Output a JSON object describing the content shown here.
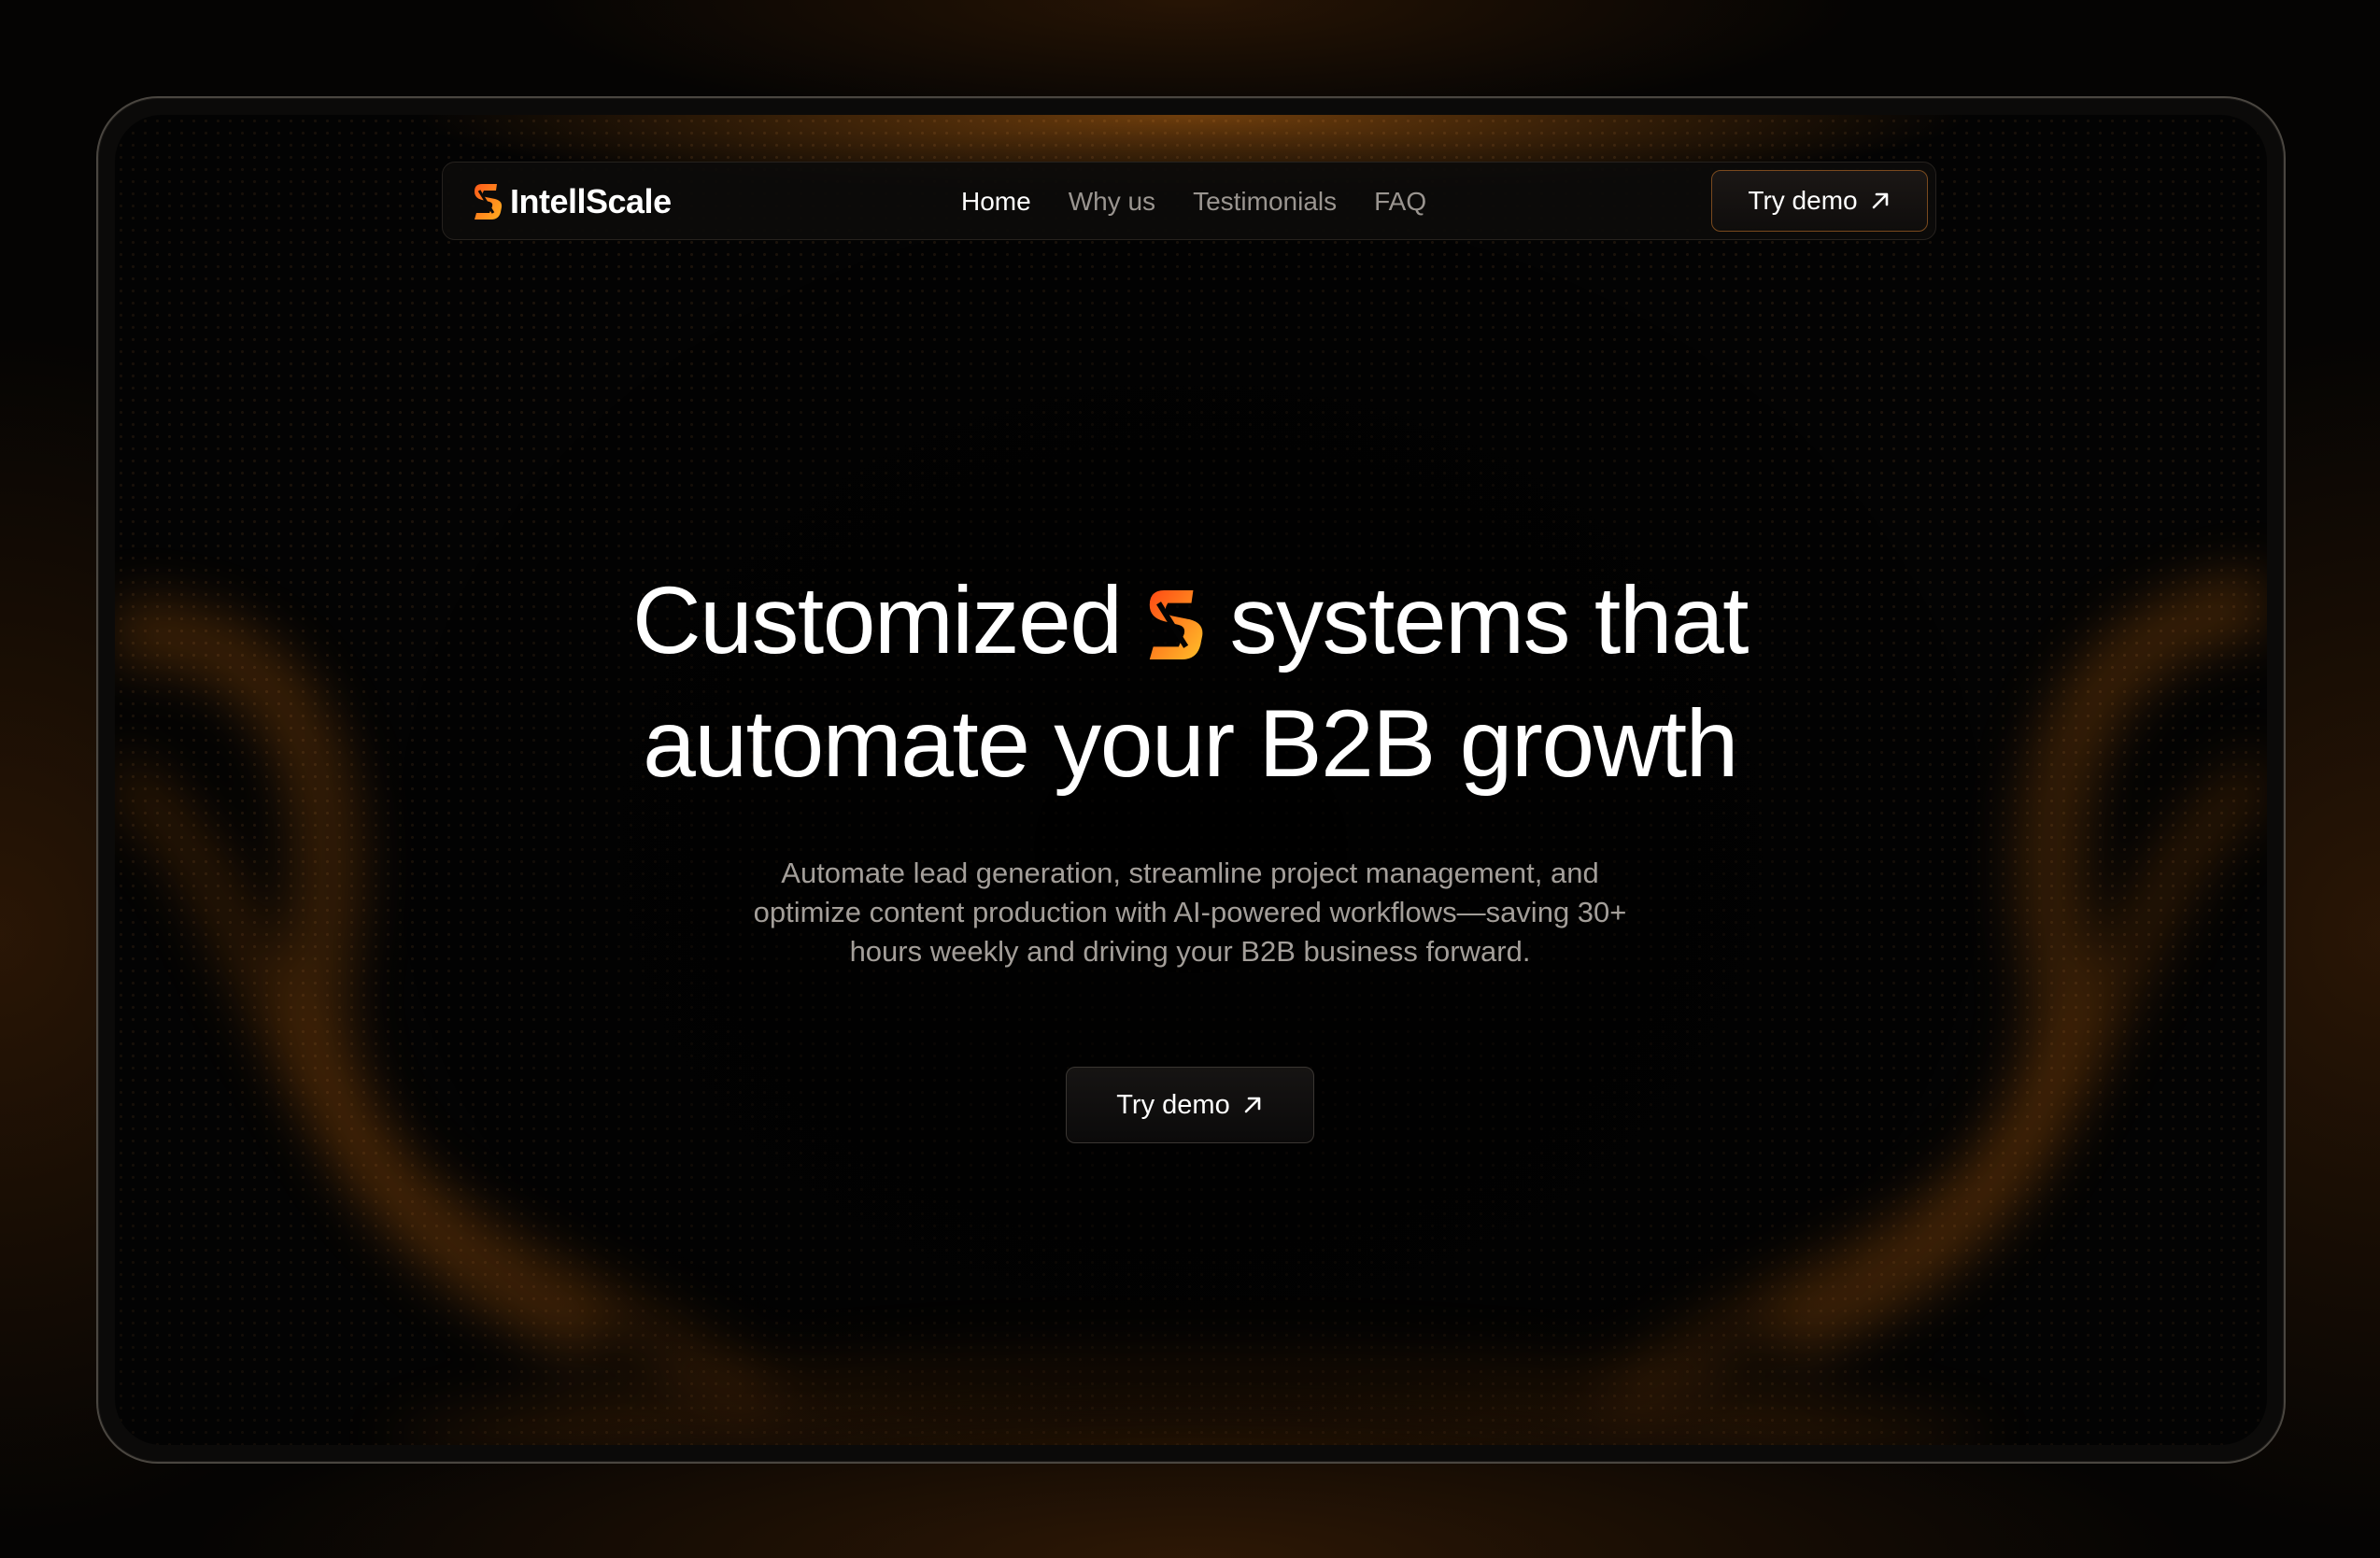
{
  "brand": {
    "name": "IntellScale",
    "logo_icon": "orange-s-bolt-logo",
    "accent_color": "#ff7a1a",
    "accent_color_secondary": "#ffb020"
  },
  "nav": {
    "items": [
      {
        "label": "Home",
        "active": true
      },
      {
        "label": "Why us",
        "active": false
      },
      {
        "label": "Testimonials",
        "active": false
      },
      {
        "label": "FAQ",
        "active": false
      }
    ],
    "cta_label": "Try demo",
    "cta_icon": "arrow-up-right-icon"
  },
  "hero": {
    "title_part1": "Customized",
    "title_part2": "systems that",
    "title_line2": "automate your B2B growth",
    "subtitle": "Automate lead generation, streamline project management, and optimize content production with AI-powered workflows—saving 30+ hours weekly and driving your B2B business forward.",
    "cta_label": "Try demo",
    "cta_icon": "arrow-up-right-icon"
  },
  "colors": {
    "background": "#000000",
    "text_primary": "#ffffff",
    "text_muted": "#a39e99",
    "glow": "#c86e14"
  }
}
